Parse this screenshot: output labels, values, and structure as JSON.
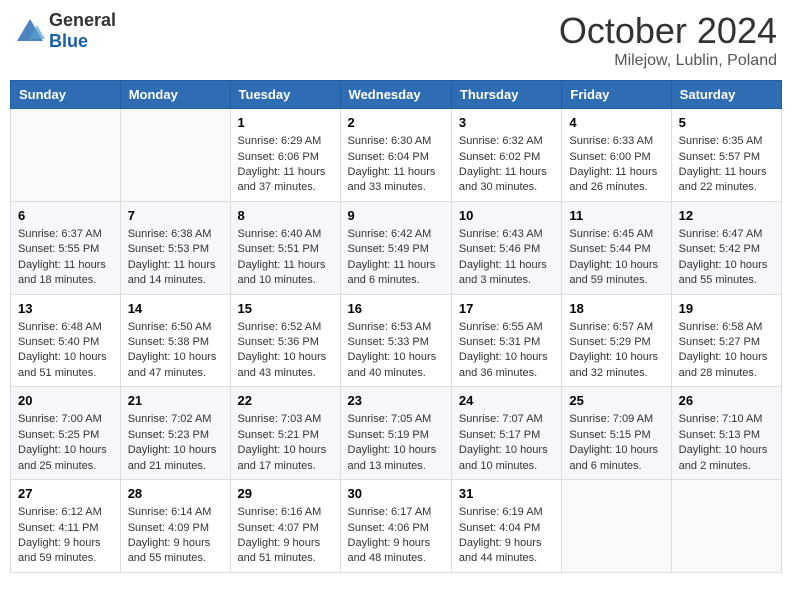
{
  "logo": {
    "general": "General",
    "blue": "Blue"
  },
  "title": "October 2024",
  "subtitle": "Milejow, Lublin, Poland",
  "headers": [
    "Sunday",
    "Monday",
    "Tuesday",
    "Wednesday",
    "Thursday",
    "Friday",
    "Saturday"
  ],
  "weeks": [
    [
      {
        "day": "",
        "info": ""
      },
      {
        "day": "",
        "info": ""
      },
      {
        "day": "1",
        "info": "Sunrise: 6:29 AM\nSunset: 6:06 PM\nDaylight: 11 hours and 37 minutes."
      },
      {
        "day": "2",
        "info": "Sunrise: 6:30 AM\nSunset: 6:04 PM\nDaylight: 11 hours and 33 minutes."
      },
      {
        "day": "3",
        "info": "Sunrise: 6:32 AM\nSunset: 6:02 PM\nDaylight: 11 hours and 30 minutes."
      },
      {
        "day": "4",
        "info": "Sunrise: 6:33 AM\nSunset: 6:00 PM\nDaylight: 11 hours and 26 minutes."
      },
      {
        "day": "5",
        "info": "Sunrise: 6:35 AM\nSunset: 5:57 PM\nDaylight: 11 hours and 22 minutes."
      }
    ],
    [
      {
        "day": "6",
        "info": "Sunrise: 6:37 AM\nSunset: 5:55 PM\nDaylight: 11 hours and 18 minutes."
      },
      {
        "day": "7",
        "info": "Sunrise: 6:38 AM\nSunset: 5:53 PM\nDaylight: 11 hours and 14 minutes."
      },
      {
        "day": "8",
        "info": "Sunrise: 6:40 AM\nSunset: 5:51 PM\nDaylight: 11 hours and 10 minutes."
      },
      {
        "day": "9",
        "info": "Sunrise: 6:42 AM\nSunset: 5:49 PM\nDaylight: 11 hours and 6 minutes."
      },
      {
        "day": "10",
        "info": "Sunrise: 6:43 AM\nSunset: 5:46 PM\nDaylight: 11 hours and 3 minutes."
      },
      {
        "day": "11",
        "info": "Sunrise: 6:45 AM\nSunset: 5:44 PM\nDaylight: 10 hours and 59 minutes."
      },
      {
        "day": "12",
        "info": "Sunrise: 6:47 AM\nSunset: 5:42 PM\nDaylight: 10 hours and 55 minutes."
      }
    ],
    [
      {
        "day": "13",
        "info": "Sunrise: 6:48 AM\nSunset: 5:40 PM\nDaylight: 10 hours and 51 minutes."
      },
      {
        "day": "14",
        "info": "Sunrise: 6:50 AM\nSunset: 5:38 PM\nDaylight: 10 hours and 47 minutes."
      },
      {
        "day": "15",
        "info": "Sunrise: 6:52 AM\nSunset: 5:36 PM\nDaylight: 10 hours and 43 minutes."
      },
      {
        "day": "16",
        "info": "Sunrise: 6:53 AM\nSunset: 5:33 PM\nDaylight: 10 hours and 40 minutes."
      },
      {
        "day": "17",
        "info": "Sunrise: 6:55 AM\nSunset: 5:31 PM\nDaylight: 10 hours and 36 minutes."
      },
      {
        "day": "18",
        "info": "Sunrise: 6:57 AM\nSunset: 5:29 PM\nDaylight: 10 hours and 32 minutes."
      },
      {
        "day": "19",
        "info": "Sunrise: 6:58 AM\nSunset: 5:27 PM\nDaylight: 10 hours and 28 minutes."
      }
    ],
    [
      {
        "day": "20",
        "info": "Sunrise: 7:00 AM\nSunset: 5:25 PM\nDaylight: 10 hours and 25 minutes."
      },
      {
        "day": "21",
        "info": "Sunrise: 7:02 AM\nSunset: 5:23 PM\nDaylight: 10 hours and 21 minutes."
      },
      {
        "day": "22",
        "info": "Sunrise: 7:03 AM\nSunset: 5:21 PM\nDaylight: 10 hours and 17 minutes."
      },
      {
        "day": "23",
        "info": "Sunrise: 7:05 AM\nSunset: 5:19 PM\nDaylight: 10 hours and 13 minutes."
      },
      {
        "day": "24",
        "info": "Sunrise: 7:07 AM\nSunset: 5:17 PM\nDaylight: 10 hours and 10 minutes."
      },
      {
        "day": "25",
        "info": "Sunrise: 7:09 AM\nSunset: 5:15 PM\nDaylight: 10 hours and 6 minutes."
      },
      {
        "day": "26",
        "info": "Sunrise: 7:10 AM\nSunset: 5:13 PM\nDaylight: 10 hours and 2 minutes."
      }
    ],
    [
      {
        "day": "27",
        "info": "Sunrise: 6:12 AM\nSunset: 4:11 PM\nDaylight: 9 hours and 59 minutes."
      },
      {
        "day": "28",
        "info": "Sunrise: 6:14 AM\nSunset: 4:09 PM\nDaylight: 9 hours and 55 minutes."
      },
      {
        "day": "29",
        "info": "Sunrise: 6:16 AM\nSunset: 4:07 PM\nDaylight: 9 hours and 51 minutes."
      },
      {
        "day": "30",
        "info": "Sunrise: 6:17 AM\nSunset: 4:06 PM\nDaylight: 9 hours and 48 minutes."
      },
      {
        "day": "31",
        "info": "Sunrise: 6:19 AM\nSunset: 4:04 PM\nDaylight: 9 hours and 44 minutes."
      },
      {
        "day": "",
        "info": ""
      },
      {
        "day": "",
        "info": ""
      }
    ]
  ]
}
